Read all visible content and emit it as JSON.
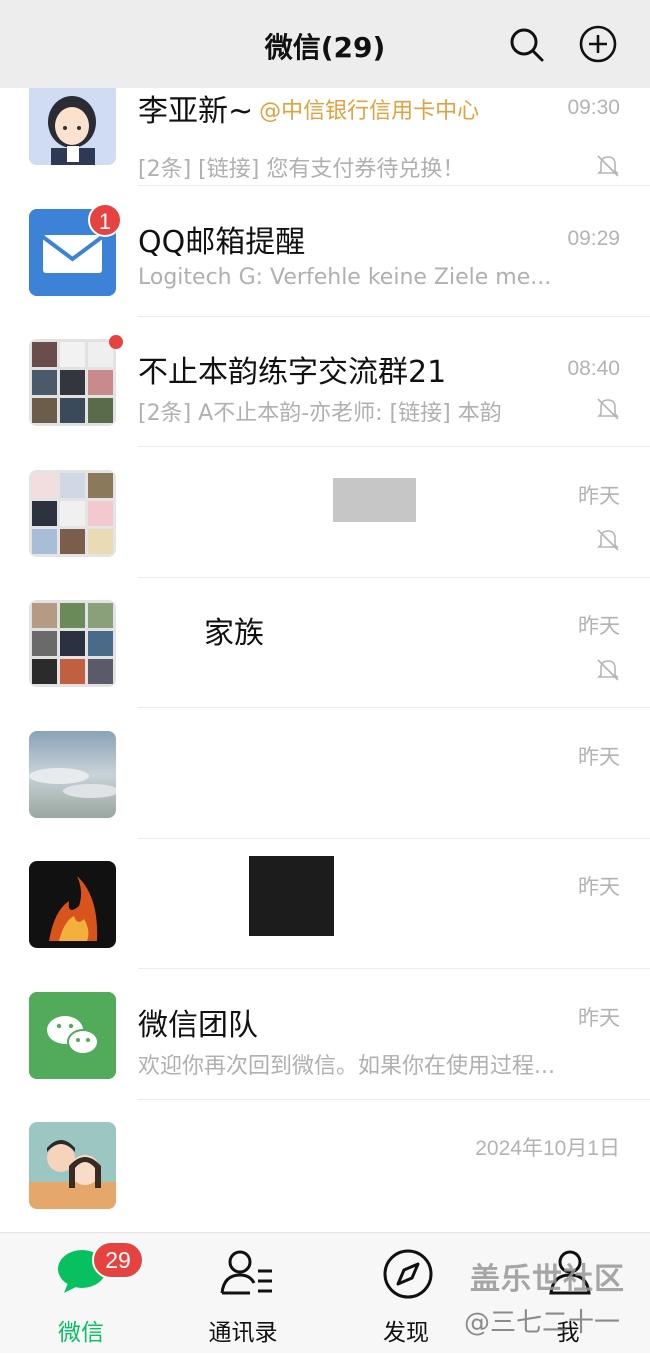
{
  "header": {
    "title": "微信(29)",
    "icons": [
      "search-icon",
      "add-circle-icon"
    ]
  },
  "chats": [
    {
      "name": "李亚新~",
      "mention": "@中信银行信用卡中心",
      "time": "09:30",
      "preview": "[2条] [链接] 您有支付券待兑换！",
      "muted": true,
      "unread_dot": true
    },
    {
      "name": "QQ邮箱提醒",
      "time": "09:29",
      "preview": "Logitech G: Verfehle keine Ziele me...",
      "muted": false,
      "badge": "1"
    },
    {
      "name": "不止本韵练字交流群21",
      "time": "08:40",
      "preview": "[2条] A不止本韵-亦老师: [链接] 本韵",
      "muted": true,
      "unread_dot": true
    },
    {
      "name": "",
      "time": "昨天",
      "preview": "",
      "muted": true
    },
    {
      "name": "家族",
      "time": "昨天",
      "preview": "",
      "muted": true
    },
    {
      "name": "",
      "time": "昨天",
      "preview": "",
      "muted": false
    },
    {
      "name": "",
      "time": "昨天",
      "preview": "",
      "muted": false
    },
    {
      "name": "微信团队",
      "time": "昨天",
      "preview": "欢迎你再次回到微信。如果你在使用过程...",
      "muted": false
    },
    {
      "name": "",
      "time": "2024年10月1日",
      "preview": "",
      "muted": false
    }
  ],
  "tabbar": {
    "tabs": [
      {
        "label": "微信",
        "icon": "chat-bubble-icon",
        "badge": "29",
        "active": true
      },
      {
        "label": "通讯录",
        "icon": "contacts-icon"
      },
      {
        "label": "发现",
        "icon": "compass-icon"
      },
      {
        "label": "我",
        "icon": "person-icon"
      }
    ]
  },
  "watermark": {
    "line1": "盖乐世社区",
    "line2": "@三七二十一"
  },
  "colors": {
    "accent": "#07c160",
    "badge": "#e64340",
    "mention": "#e0a23f",
    "header_bg": "#ededed"
  }
}
